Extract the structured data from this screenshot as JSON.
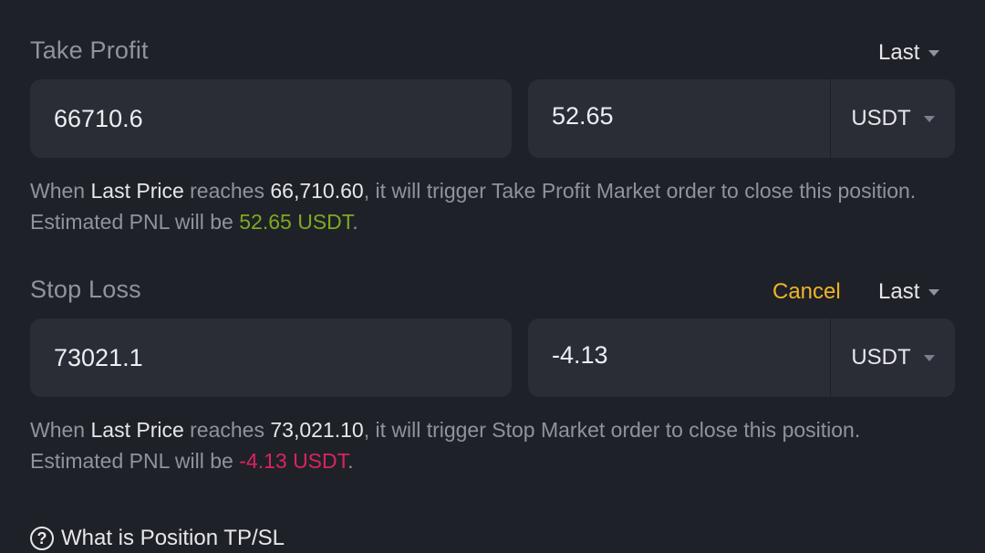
{
  "take_profit": {
    "title": "Take Profit",
    "trigger_type": "Last",
    "price_value": "66710.6",
    "pnl_value": "52.65",
    "unit": "USDT",
    "desc": {
      "p1": "When ",
      "price_type": "Last Price",
      "p2": " reaches ",
      "price": "66,710.60",
      "p3": ", it will trigger Take Profit Market order to close this position. Estimated PNL will be ",
      "pnl": "52.65 USDT",
      "p4": "."
    }
  },
  "stop_loss": {
    "title": "Stop Loss",
    "cancel_label": "Cancel",
    "trigger_type": "Last",
    "price_value": "73021.1",
    "pnl_value": "-4.13",
    "unit": "USDT",
    "desc": {
      "p1": "When ",
      "price_type": "Last Price",
      "p2": " reaches ",
      "price": "73,021.10",
      "p3": ", it will trigger Stop Market order to close this position. Estimated PNL will be ",
      "pnl": "-4.13 USDT",
      "p4": "."
    }
  },
  "help": {
    "icon": "question-circle-icon",
    "label": "What is Position TP/SL"
  },
  "colors": {
    "background": "#1f2128",
    "field": "#2a2d35",
    "accent_cancel": "#f0b429",
    "profit": "#7fa91f",
    "loss": "#d9245f"
  }
}
